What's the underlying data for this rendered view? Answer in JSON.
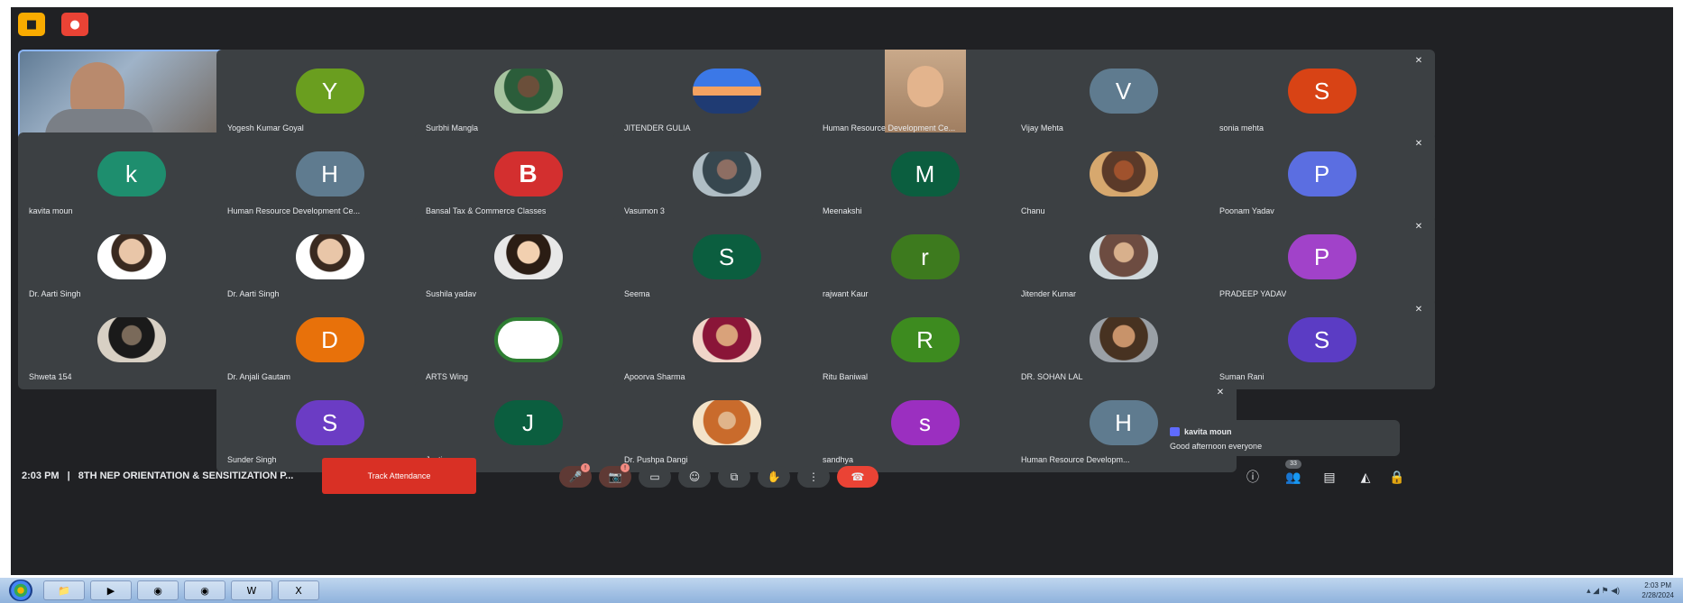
{
  "top_badges": {
    "yellow_icon": "meeting-icon",
    "red_icon": "record-icon"
  },
  "self_view": {
    "name": "",
    "speaking_badge": "•••"
  },
  "tiles": [
    {
      "name": "Yogesh Kumar Goyal",
      "initial": "Y",
      "color": "#6a9e1f"
    },
    {
      "name": "Surbhi Mangla",
      "initial": "",
      "color": ""
    },
    {
      "name": "JITENDER GULIA",
      "initial": "",
      "color": ""
    },
    {
      "name": "Human Resource Development Ce...",
      "initial": "",
      "color": ""
    },
    {
      "name": "Vijay Mehta",
      "initial": "V",
      "color": "#5f7b8f"
    },
    {
      "name": "sonia mehta",
      "initial": "S",
      "color": "#d84315"
    },
    {
      "name": "kavita moun",
      "initial": "k",
      "color": "#1e8e6e"
    },
    {
      "name": "Human Resource Development Ce...",
      "initial": "H",
      "color": "#5f7b8f"
    },
    {
      "name": "Bansal Tax & Commerce Classes",
      "initial": "",
      "color": ""
    },
    {
      "name": "Vasumon 3",
      "initial": "",
      "color": ""
    },
    {
      "name": "Meenakshi",
      "initial": "M",
      "color": "#0b5e3f"
    },
    {
      "name": "Chanu",
      "initial": "",
      "color": ""
    },
    {
      "name": "Poonam Yadav",
      "initial": "P",
      "color": "#5b6ee1"
    },
    {
      "name": "Dr. Aarti Singh",
      "initial": "",
      "color": ""
    },
    {
      "name": "Dr. Aarti Singh",
      "initial": "",
      "color": ""
    },
    {
      "name": "Sushila yadav",
      "initial": "",
      "color": ""
    },
    {
      "name": "Seema",
      "initial": "S",
      "color": "#0b5e3f"
    },
    {
      "name": "rajwant Kaur",
      "initial": "r",
      "color": "#3d7a1e"
    },
    {
      "name": "Jitender Kumar",
      "initial": "",
      "color": ""
    },
    {
      "name": "PRADEEP YADAV",
      "initial": "P",
      "color": "#a142c9"
    },
    {
      "name": "Shweta 154",
      "initial": "",
      "color": ""
    },
    {
      "name": "Dr. Anjali Gautam",
      "initial": "D",
      "color": "#e8710a"
    },
    {
      "name": "ARTS Wing",
      "initial": "",
      "color": ""
    },
    {
      "name": "Apoorva Sharma",
      "initial": "",
      "color": ""
    },
    {
      "name": "Ritu Baniwal",
      "initial": "R",
      "color": "#3d8b1f"
    },
    {
      "name": "DR. SOHAN LAL",
      "initial": "",
      "color": ""
    },
    {
      "name": "Suman Rani",
      "initial": "S",
      "color": "#5b3cc4"
    },
    {
      "name": "Sunder Singh",
      "initial": "S",
      "color": "#6b3cc4"
    },
    {
      "name": "Jyoti",
      "initial": "J",
      "color": "#0b5e3f"
    },
    {
      "name": "Dr. Pushpa Dangi",
      "initial": "",
      "color": ""
    },
    {
      "name": "sandhya",
      "initial": "s",
      "color": "#9b2fc0"
    },
    {
      "name": "Human Resource Developm...",
      "initial": "H",
      "color": "#5f7b8f"
    }
  ],
  "chat_toast": {
    "sender": "kavita moun",
    "message": "Good afternoon everyone"
  },
  "bottom_bar": {
    "time": "2:03 PM",
    "separator": "|",
    "meeting_title": "8TH NEP ORIENTATION & SENSITIZATION P...",
    "track_attendance_label": "Track Attendance",
    "participants_count": "33"
  },
  "taskbar": {
    "clock_time": "2:03 PM",
    "clock_date": "2/28/2024"
  }
}
